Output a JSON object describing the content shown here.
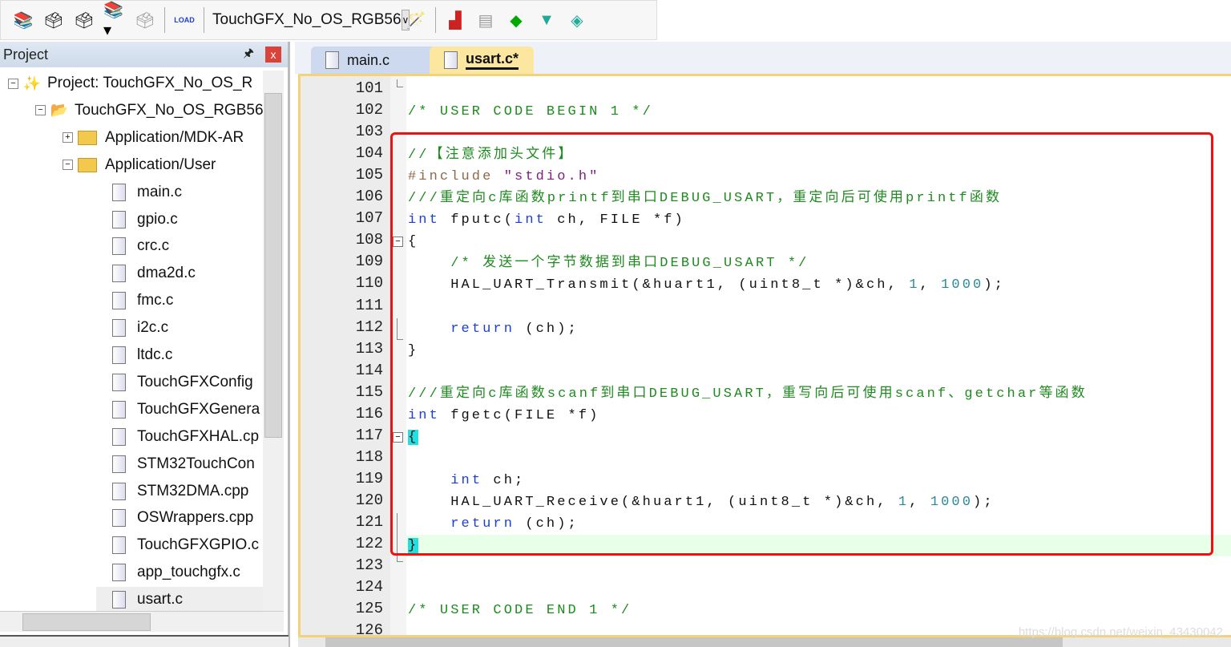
{
  "toolbar": {
    "target": "TouchGFX_No_OS_RGB56",
    "load_label": "LOAD"
  },
  "project_panel": {
    "title": "Project",
    "pin": "📌",
    "close": "x",
    "items": [
      {
        "label": "Project: TouchGFX_No_OS_R",
        "type": "project",
        "expander": "−",
        "level": 0
      },
      {
        "label": "TouchGFX_No_OS_RGB56",
        "type": "target",
        "expander": "−",
        "level": 1
      },
      {
        "label": "Application/MDK-AR",
        "type": "folder",
        "expander": "+",
        "level": 2
      },
      {
        "label": "Application/User",
        "type": "folder",
        "expander": "−",
        "level": 2
      },
      {
        "label": "main.c",
        "type": "file",
        "level": 3
      },
      {
        "label": "gpio.c",
        "type": "file",
        "level": 3
      },
      {
        "label": "crc.c",
        "type": "file",
        "level": 3
      },
      {
        "label": "dma2d.c",
        "type": "file",
        "level": 3
      },
      {
        "label": "fmc.c",
        "type": "file",
        "level": 3
      },
      {
        "label": "i2c.c",
        "type": "file",
        "level": 3
      },
      {
        "label": "ltdc.c",
        "type": "file",
        "level": 3
      },
      {
        "label": "TouchGFXConfig",
        "type": "file",
        "level": 3
      },
      {
        "label": "TouchGFXGenera",
        "type": "file",
        "level": 3
      },
      {
        "label": "TouchGFXHAL.cp",
        "type": "file",
        "level": 3
      },
      {
        "label": "STM32TouchCon",
        "type": "file",
        "level": 3
      },
      {
        "label": "STM32DMA.cpp",
        "type": "file",
        "level": 3
      },
      {
        "label": "OSWrappers.cpp",
        "type": "file",
        "level": 3
      },
      {
        "label": "TouchGFXGPIO.c",
        "type": "file",
        "level": 3
      },
      {
        "label": "app_touchgfx.c",
        "type": "file",
        "level": 3
      },
      {
        "label": "usart.c",
        "type": "file",
        "level": 3,
        "selected": true
      }
    ]
  },
  "tabs": [
    {
      "label": "main.c",
      "active": false
    },
    {
      "label": "usart.c*",
      "active": true
    }
  ],
  "editor": {
    "current_line": 122,
    "lines": [
      {
        "n": "101",
        "tokens": []
      },
      {
        "n": "102",
        "tokens": [
          {
            "t": "/* USER CODE BEGIN 1 */",
            "c": "cm"
          }
        ]
      },
      {
        "n": "103",
        "tokens": []
      },
      {
        "n": "104",
        "tokens": [
          {
            "t": "//【注意添加头文件】",
            "c": "cm"
          }
        ]
      },
      {
        "n": "105",
        "tokens": [
          {
            "t": "#include ",
            "c": "pp"
          },
          {
            "t": "\"stdio.h\"",
            "c": "st"
          }
        ]
      },
      {
        "n": "106",
        "tokens": [
          {
            "t": "///重定向c库函数printf到串口DEBUG_USART，重定向后可使用printf函数",
            "c": "cm"
          }
        ]
      },
      {
        "n": "107",
        "tokens": [
          {
            "t": "int",
            "c": "kw"
          },
          {
            "t": " fputc(",
            "c": ""
          },
          {
            "t": "int",
            "c": "kw"
          },
          {
            "t": " ch, FILE *f)",
            "c": ""
          }
        ]
      },
      {
        "n": "108",
        "tokens": [
          {
            "t": "{",
            "c": ""
          }
        ]
      },
      {
        "n": "109",
        "tokens": [
          {
            "t": "    ",
            "c": ""
          },
          {
            "t": "/* 发送一个字节数据到串口DEBUG_USART */",
            "c": "cm"
          }
        ]
      },
      {
        "n": "110",
        "tokens": [
          {
            "t": "    HAL_UART_Transmit(&huart1, (uint8_t *)&ch, ",
            "c": ""
          },
          {
            "t": "1",
            "c": "nm"
          },
          {
            "t": ", ",
            "c": ""
          },
          {
            "t": "1000",
            "c": "nm"
          },
          {
            "t": ");",
            "c": ""
          }
        ]
      },
      {
        "n": "111",
        "tokens": []
      },
      {
        "n": "112",
        "tokens": [
          {
            "t": "    ",
            "c": ""
          },
          {
            "t": "return",
            "c": "kw"
          },
          {
            "t": " (ch);",
            "c": ""
          }
        ]
      },
      {
        "n": "113",
        "tokens": [
          {
            "t": "}",
            "c": ""
          }
        ]
      },
      {
        "n": "114",
        "tokens": []
      },
      {
        "n": "115",
        "tokens": [
          {
            "t": "///重定向c库函数scanf到串口DEBUG_USART，重写向后可使用scanf、getchar等函数",
            "c": "cm"
          }
        ]
      },
      {
        "n": "116",
        "tokens": [
          {
            "t": "int",
            "c": "kw"
          },
          {
            "t": " fgetc(FILE *f)",
            "c": ""
          }
        ]
      },
      {
        "n": "117",
        "tokens": [
          {
            "t": "{",
            "c": "br"
          }
        ]
      },
      {
        "n": "118",
        "tokens": []
      },
      {
        "n": "119",
        "tokens": [
          {
            "t": "    ",
            "c": ""
          },
          {
            "t": "int",
            "c": "kw"
          },
          {
            "t": " ch;",
            "c": ""
          }
        ]
      },
      {
        "n": "120",
        "tokens": [
          {
            "t": "    HAL_UART_Receive(&huart1, (uint8_t *)&ch, ",
            "c": ""
          },
          {
            "t": "1",
            "c": "nm"
          },
          {
            "t": ", ",
            "c": ""
          },
          {
            "t": "1000",
            "c": "nm"
          },
          {
            "t": ");",
            "c": ""
          }
        ]
      },
      {
        "n": "121",
        "tokens": [
          {
            "t": "    ",
            "c": ""
          },
          {
            "t": "return",
            "c": "kw"
          },
          {
            "t": " (ch);",
            "c": ""
          }
        ]
      },
      {
        "n": "122",
        "tokens": [
          {
            "t": "}",
            "c": "br"
          }
        ]
      },
      {
        "n": "123",
        "tokens": []
      },
      {
        "n": "124",
        "tokens": []
      },
      {
        "n": "125",
        "tokens": [
          {
            "t": "/* USER CODE END 1 */",
            "c": "cm"
          }
        ]
      },
      {
        "n": "126",
        "tokens": []
      }
    ]
  },
  "watermark": "https://blog.csdn.net/weixin_43430042",
  "colors": {
    "highlight_box": "#f01010",
    "comment": "#1f8a1f",
    "keyword": "#1b3fd6",
    "active_tab": "#fbe7a0"
  }
}
